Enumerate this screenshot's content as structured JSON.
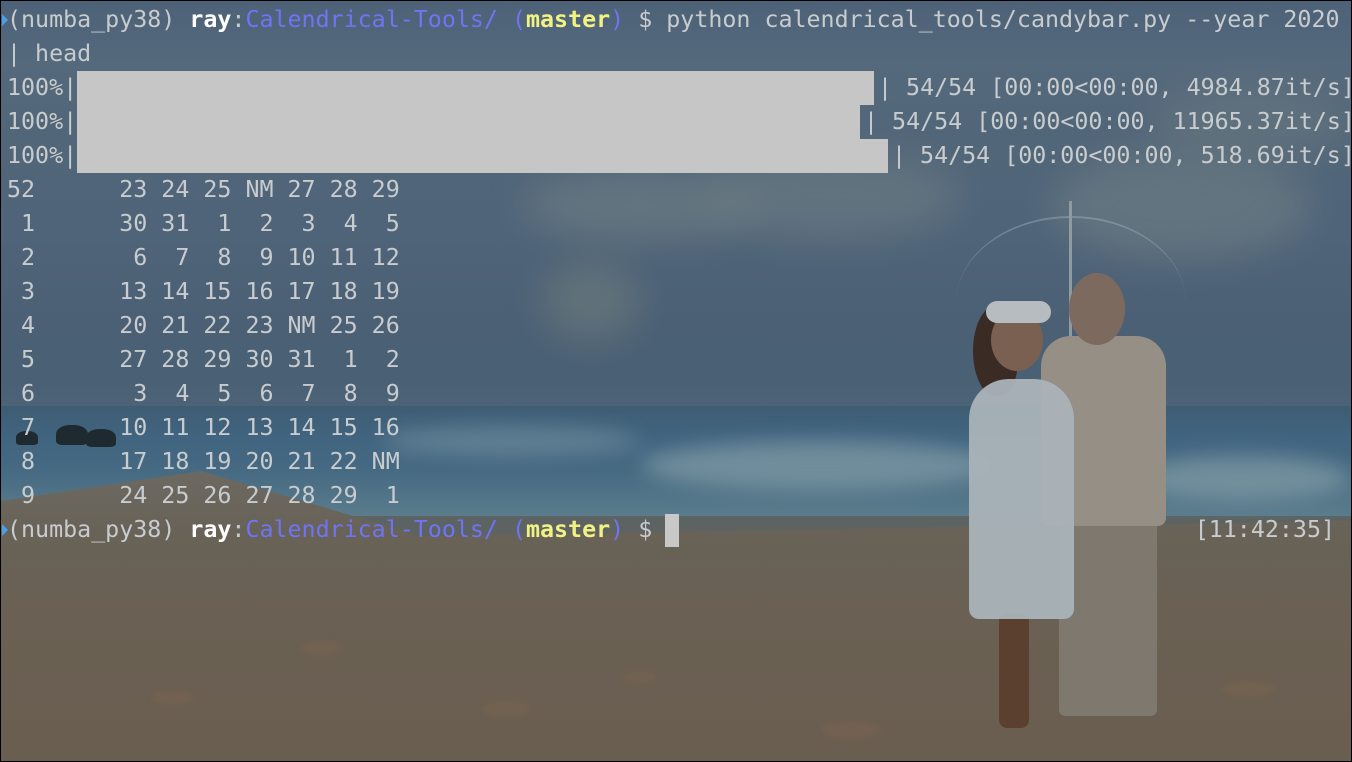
{
  "prompt": {
    "env": "(numba_py38)",
    "user": "ray",
    "separator": ":",
    "path": "Calendrical-Tools/",
    "branch_open": "(",
    "branch": "master",
    "branch_close": ")",
    "symbol": "$"
  },
  "command": {
    "text": "python calendrical_tools/candybar.py --year 2020",
    "continuation": "| head"
  },
  "progress_bars": [
    {
      "percent_label": "100%|",
      "progress": 1.0,
      "suffix": "| 54/54 [00:00<00:00, 4984.87it/s]"
    },
    {
      "percent_label": "100%|",
      "progress": 1.0,
      "suffix": "| 54/54 [00:00<00:00, 11965.37it/s]"
    },
    {
      "percent_label": "100%|",
      "progress": 1.0,
      "suffix": "| 54/54 [00:00<00:00, 518.69it/s]"
    }
  ],
  "calendar_rows": [
    {
      "week": "52",
      "days": "23 24 25 NM 27 28 29"
    },
    {
      "week": " 1",
      "days": "30 31  1  2  3  4  5"
    },
    {
      "week": " 2",
      "days": " 6  7  8  9 10 11 12"
    },
    {
      "week": " 3",
      "days": "13 14 15 16 17 18 19"
    },
    {
      "week": " 4",
      "days": "20 21 22 23 NM 25 26"
    },
    {
      "week": " 5",
      "days": "27 28 29 30 31  1  2"
    },
    {
      "week": " 6",
      "days": " 3  4  5  6  7  8  9"
    },
    {
      "week": " 7",
      "days": "10 11 12 13 14 15 16"
    },
    {
      "week": " 8",
      "days": "17 18 19 20 21 22 NM"
    },
    {
      "week": " 9",
      "days": "24 25 26 27 28 29  1"
    }
  ],
  "right_prompt": {
    "clock": "[11:42:35]"
  },
  "colors": {
    "path": "#6f74f4",
    "branch": "#f2f283",
    "user": "#ffffff",
    "text": "#c8ccce",
    "progress_fill": "#c6c6c6",
    "prompt_arrow": "#4aa0e6"
  }
}
